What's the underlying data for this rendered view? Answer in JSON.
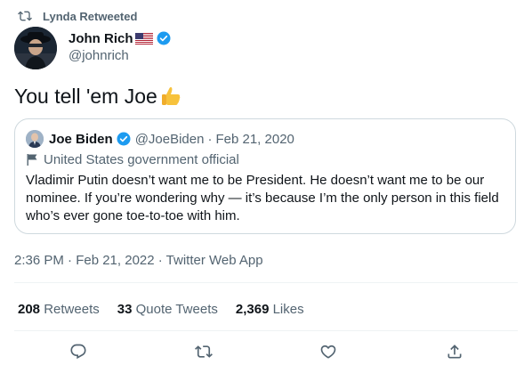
{
  "retweet_header": {
    "label": "Lynda Retweeted",
    "icon": "retweet-icon"
  },
  "author": {
    "name": "John Rich",
    "flag": "🇺🇸",
    "handle": "@johnrich",
    "verified": true
  },
  "tweet": {
    "text": "You tell 'em Joe",
    "emoji": "👍"
  },
  "quoted_tweet": {
    "name": "Joe Biden",
    "handle": "@JoeBiden",
    "separator": "·",
    "date": "Feb 21, 2020",
    "label": "United States government official",
    "body": "Vladimir Putin doesn’t want me to be President. He doesn’t want me to be our nominee. If you’re wondering why — it’s because I’m the only person in this field who’s ever gone toe-to-toe with him."
  },
  "meta": {
    "timestamp": "2:36 PM · Feb 21, 2022 · Twitter Web App"
  },
  "stats": {
    "retweets": {
      "count": "208",
      "label": "Retweets"
    },
    "quotes": {
      "count": "33",
      "label": "Quote Tweets"
    },
    "likes": {
      "count": "2,369",
      "label": "Likes"
    }
  },
  "actions": [
    "reply-icon",
    "retweet-icon",
    "like-icon",
    "share-icon"
  ],
  "colors": {
    "text": "#0f1419",
    "muted": "#536471",
    "verified": "#1d9bf0",
    "border": "#cfd9de"
  }
}
